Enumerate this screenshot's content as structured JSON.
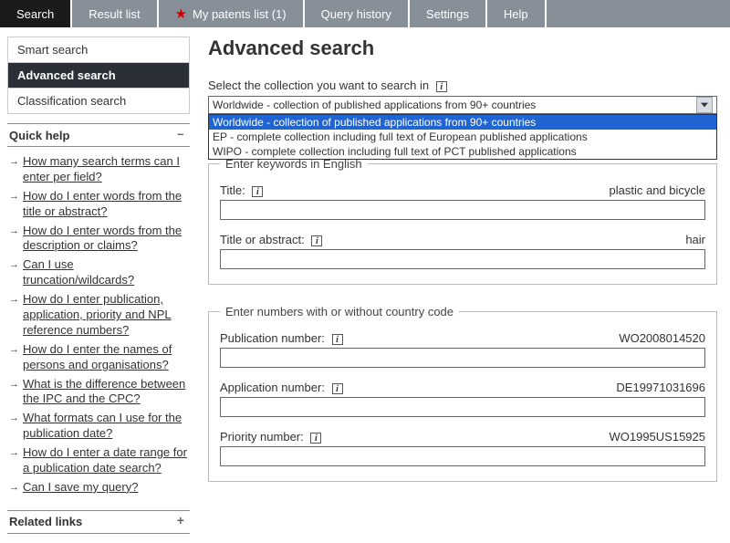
{
  "tabs": [
    {
      "label": "Search",
      "active": true
    },
    {
      "label": "Result list"
    },
    {
      "label": "My patents list (1)",
      "star": true
    },
    {
      "label": "Query history"
    },
    {
      "label": "Settings"
    },
    {
      "label": "Help"
    }
  ],
  "sidebar_items": [
    {
      "label": "Smart search"
    },
    {
      "label": "Advanced search",
      "active": true
    },
    {
      "label": "Classification search"
    }
  ],
  "quickhelp_title": "Quick help",
  "quickhelp_collapse": "–",
  "quickhelp": [
    "How many search terms can I enter per field?",
    "How do I enter words from the title or abstract?",
    "How do I enter words from the description or claims?",
    "Can I use truncation/wildcards?",
    "How do I enter publication, application, priority and NPL reference numbers?",
    "How do I enter the names of persons and organisations?",
    "What is the difference between the IPC and the CPC?",
    "What formats can I use for the publication date?",
    "How do I enter a date range for a publication date search?",
    "Can I save my query?"
  ],
  "related_title": "Related links",
  "related_collapse": "+",
  "heading": "Advanced search",
  "collection_label": "Select the collection you want to search in",
  "collection_selected": "Worldwide - collection of published applications from 90+ countries",
  "collection_options": [
    "Worldwide - collection of published applications from 90+ countries",
    "EP - complete collection including full text of European published applications",
    "WIPO - complete collection including full text of PCT published applications"
  ],
  "lang_prefix": "En",
  "keywords_legend": "Enter keywords in English",
  "field_title_label": "Title:",
  "field_title_hint": "plastic and bicycle",
  "field_abstract_label": "Title or abstract:",
  "field_abstract_hint": "hair",
  "numbers_legend": "Enter numbers with or without country code",
  "field_pub_label": "Publication number:",
  "field_pub_hint": "WO2008014520",
  "field_app_label": "Application number:",
  "field_app_hint": "DE19971031696",
  "field_prio_label": "Priority number:",
  "field_prio_hint": "WO1995US15925"
}
